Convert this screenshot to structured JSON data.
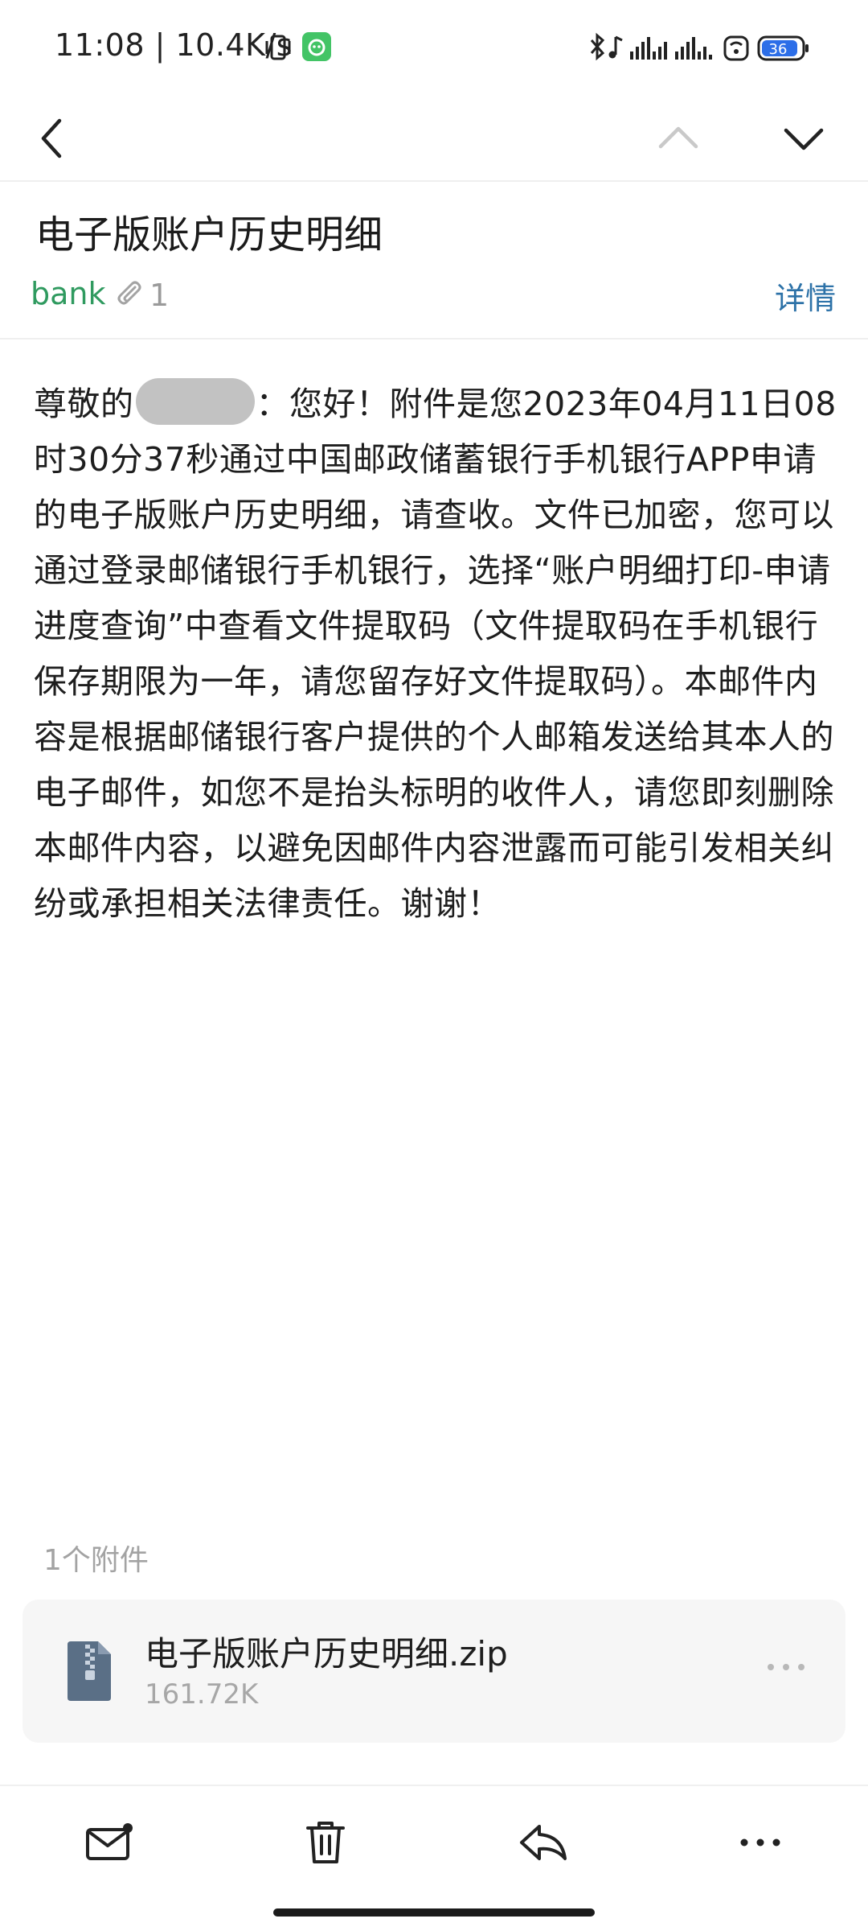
{
  "status_bar": {
    "time": "11:08 | 10.4K/s",
    "battery": "36"
  },
  "email": {
    "subject": "电子版账户历史明细",
    "sender": "bank",
    "attachment_count": "1",
    "details_label": "详情",
    "body_greeting": "尊敬的",
    "body_text": "：您好！附件是您2023年04月11日08时30分37秒通过中国邮政储蓄银行手机银行APP申请的电子版账户历史明细，请查收。文件已加密，您可以通过登录邮储银行手机银行，选择“账户明细打印-申请进度查询”中查看文件提取码（文件提取码在手机银行保存期限为一年，请您留存好文件提取码）。本邮件内容是根据邮储银行客户提供的个人邮箱发送给其本人的电子邮件，如您不是抬头标明的收件人，请您即刻删除本邮件内容，以避免因邮件内容泄露而可能引发相关纠纷或承担相关法律责任。谢谢！"
  },
  "attachments": {
    "count_label": "1个附件",
    "items": [
      {
        "name": "电子版账户历史明细.zip",
        "size": "161.72K",
        "icon": "zip-file-icon"
      }
    ]
  },
  "icons": {
    "back": "chevron-left-icon",
    "prev": "chevron-up-icon",
    "next": "chevron-down-icon",
    "mark_unread": "mail-unread-icon",
    "delete": "trash-icon",
    "reply": "reply-icon",
    "more": "more-horizontal-icon",
    "paperclip": "paperclip-icon"
  },
  "colors": {
    "sender": "#2f9a5f",
    "details_link": "#2d72a8",
    "app_badge": "#43c466",
    "zip_icon": "#5a6f86"
  }
}
